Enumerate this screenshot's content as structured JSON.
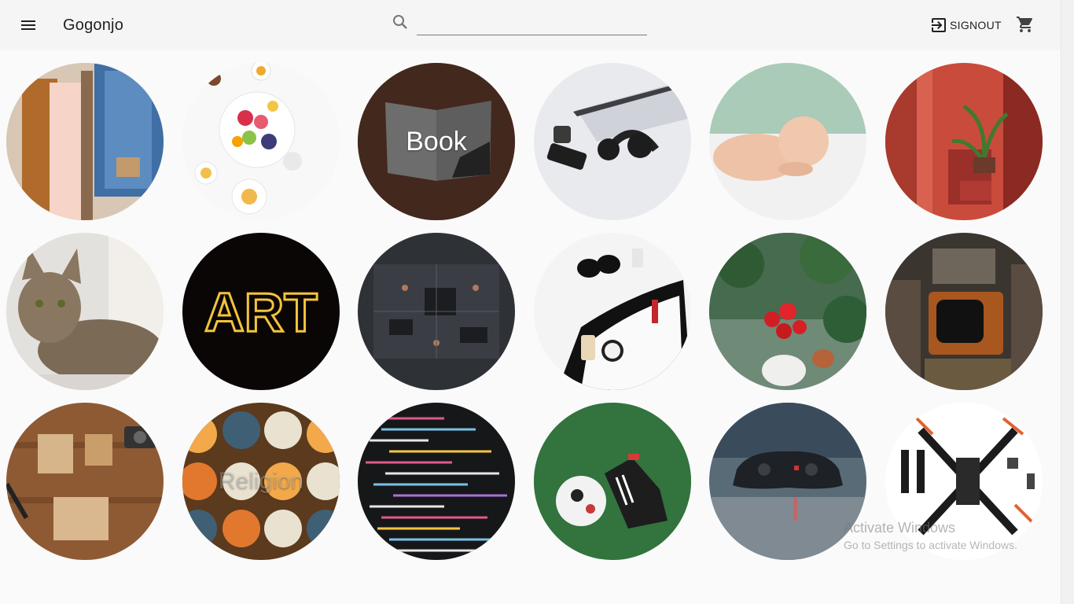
{
  "app": {
    "title": "Gogonjo"
  },
  "search": {
    "placeholder": ""
  },
  "header": {
    "signout_label": "SIGNOUT"
  },
  "icons": {
    "menu": "menu-icon",
    "search": "search-icon",
    "signout": "exit-to-app-icon",
    "cart": "shopping-cart-icon"
  },
  "categories": [
    {
      "label": ""
    },
    {
      "label": ""
    },
    {
      "label": "Book"
    },
    {
      "label": ""
    },
    {
      "label": ""
    },
    {
      "label": ""
    },
    {
      "label": ""
    },
    {
      "label": ""
    },
    {
      "label": ""
    },
    {
      "label": ""
    },
    {
      "label": ""
    },
    {
      "label": ""
    },
    {
      "label": ""
    },
    {
      "label": "Religion"
    },
    {
      "label": ""
    },
    {
      "label": ""
    },
    {
      "label": ""
    },
    {
      "label": ""
    }
  ],
  "neon_sign": {
    "text": "ART"
  },
  "watermark": {
    "line1": "Activate Windows",
    "line2": "Go to Settings to activate Windows."
  }
}
